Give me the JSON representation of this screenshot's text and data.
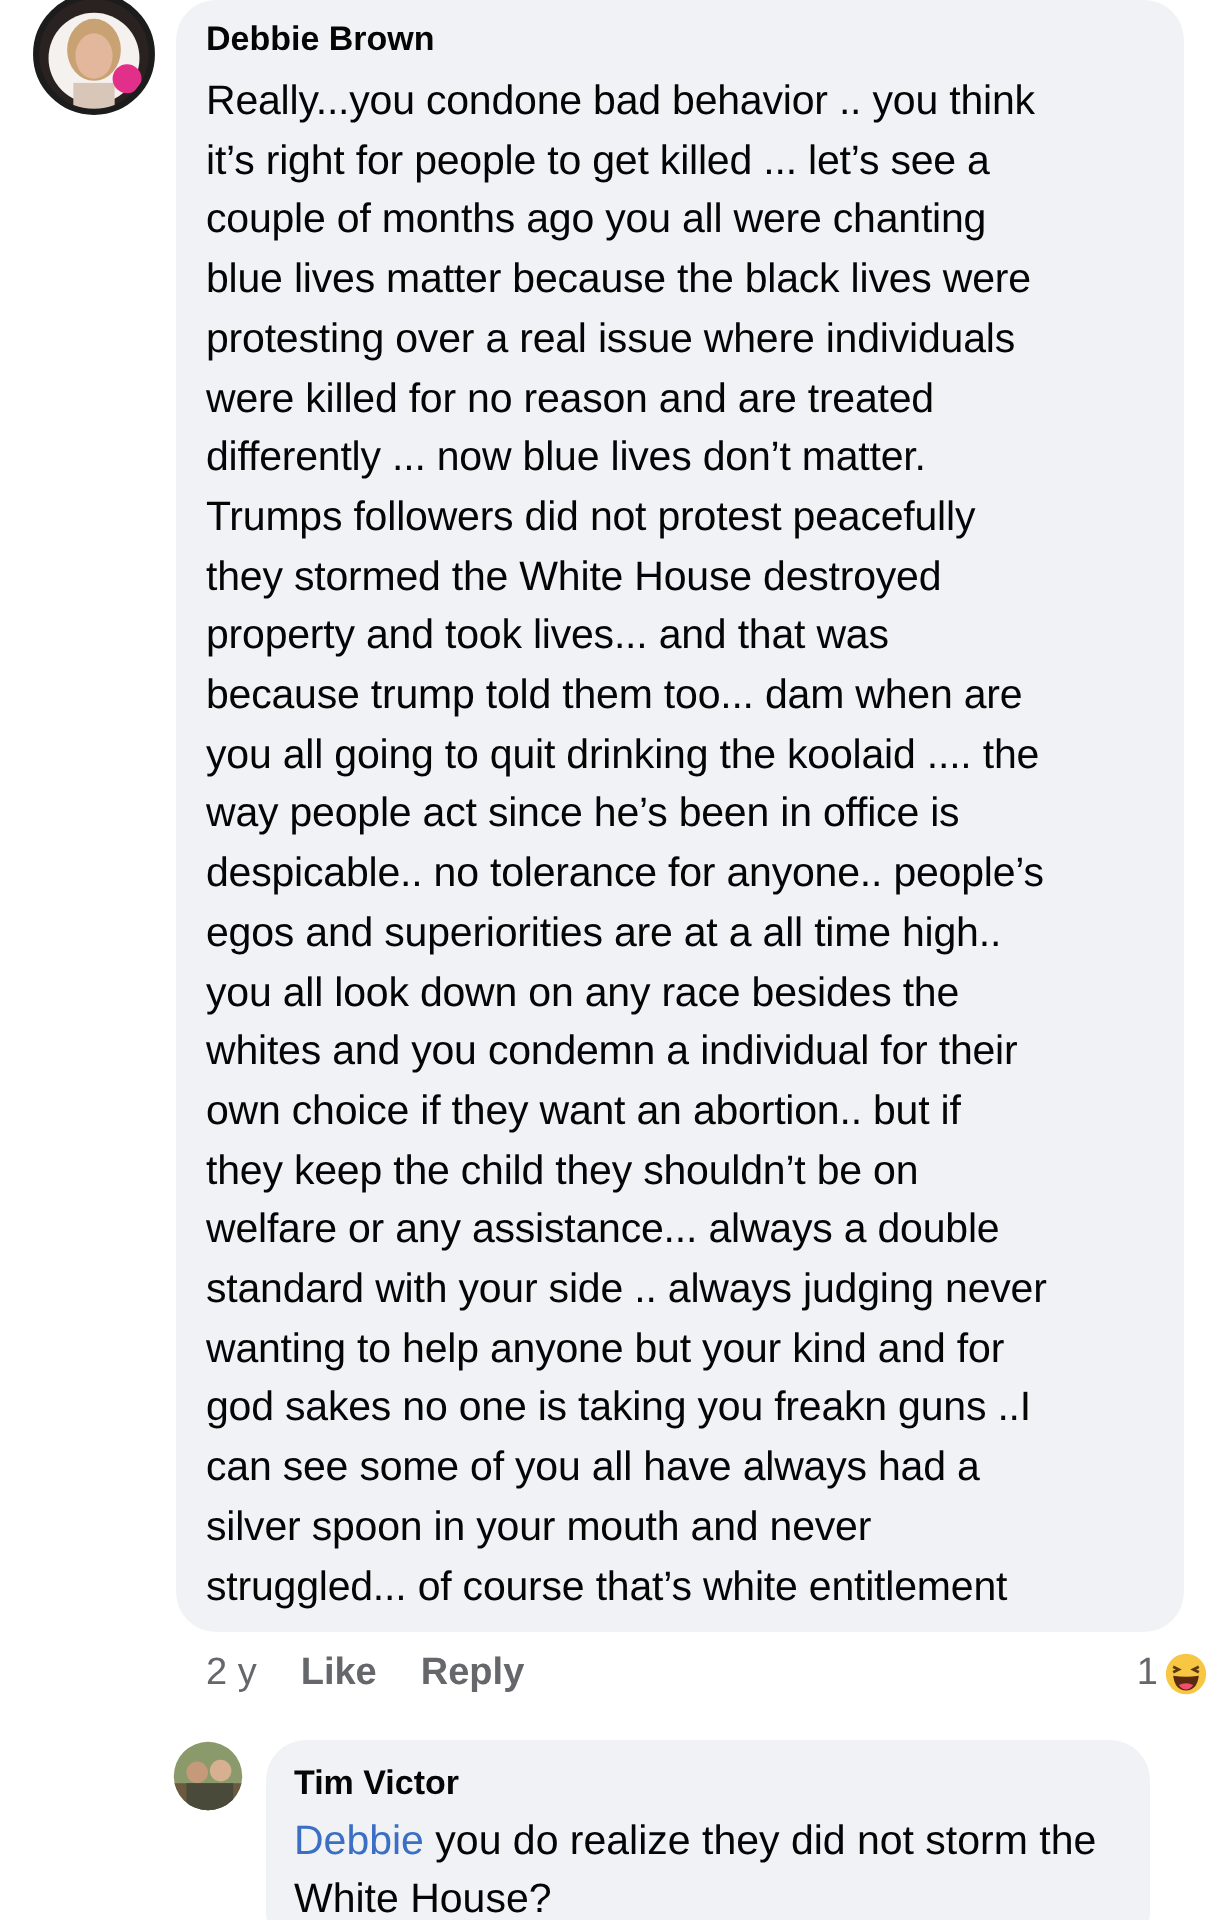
{
  "comment": {
    "author": "Debbie Brown",
    "lines": [
      "Really...you condone bad behavior .. you think",
      "it’s right for people to get killed ... let’s see a",
      "couple of months ago you all were chanting",
      "blue lives matter because the black lives were",
      "protesting over a real issue where individuals",
      "were killed for no reason and are treated",
      "differently ... now blue lives don’t matter.",
      "Trumps followers did not protest peacefully",
      "they stormed the White House destroyed",
      "property and took lives... and that was",
      "because trump told them too... dam when are",
      "you all going to quit drinking the koolaid .... the",
      "way people act since he’s been in office is",
      "despicable.. no tolerance for anyone.. people’s",
      "egos and superiorities are at a all time high..",
      "you all look down on any race besides the",
      "whites and you condemn a individual for their",
      "own choice if they want an abortion.. but if",
      "they keep the child they shouldn’t be on",
      "welfare or any assistance... always a double",
      "standard with your side .. always judging never",
      "wanting to help anyone but your kind and for",
      "god sakes no one is taking you freakn guns ..I",
      "can see some of you all have always had a",
      "silver spoon in your mouth and never",
      "struggled... of course that’s white entitlement"
    ],
    "time": "2 y",
    "actions": [
      "Like",
      "Reply"
    ],
    "reaction_count": "1"
  },
  "reply": {
    "author": "Tim Victor",
    "mention": "Debbie",
    "text": " you do realize they did not storm the White House?"
  }
}
